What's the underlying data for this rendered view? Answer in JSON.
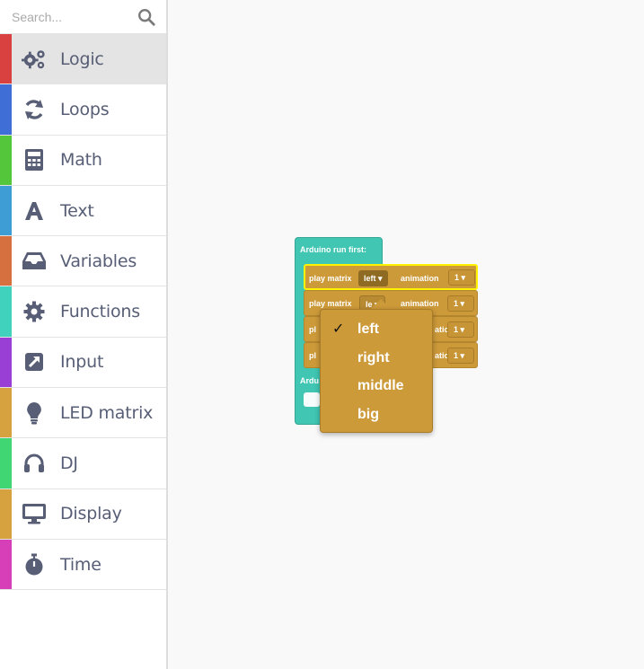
{
  "search": {
    "placeholder": "Search..."
  },
  "sidebar": {
    "categories": [
      {
        "label": "Logic",
        "color": "#d94040",
        "icon": "gears-icon",
        "selected": true
      },
      {
        "label": "Loops",
        "color": "#3f6fd6",
        "icon": "refresh-icon"
      },
      {
        "label": "Math",
        "color": "#53c63b",
        "icon": "calculator-icon"
      },
      {
        "label": "Text",
        "color": "#3f9dd6",
        "icon": "font-icon"
      },
      {
        "label": "Variables",
        "color": "#d6703f",
        "icon": "inbox-icon"
      },
      {
        "label": "Functions",
        "color": "#40d2bd",
        "icon": "gear-icon"
      },
      {
        "label": "Input",
        "color": "#9a3fd6",
        "icon": "external-arrow-icon"
      },
      {
        "label": "LED matrix",
        "color": "#d6a13f",
        "icon": "lightbulb-icon"
      },
      {
        "label": "DJ",
        "color": "#3fd673",
        "icon": "headphones-icon"
      },
      {
        "label": "Display",
        "color": "#d6a13f",
        "icon": "monitor-icon"
      },
      {
        "label": "Time",
        "color": "#d63fb8",
        "icon": "stopwatch-icon"
      }
    ]
  },
  "workspace": {
    "hat_title": "Arduino run first:",
    "hat_title2": "Ardu",
    "blocks": [
      {
        "prefix": "play matrix",
        "value": "left",
        "suffix": "animation",
        "number": "1"
      },
      {
        "prefix": "play matrix",
        "value": "le",
        "suffix": "animation",
        "number": "1"
      },
      {
        "prefix": "pl",
        "value": "",
        "suffix": "ation",
        "number": "1"
      },
      {
        "prefix": "pl",
        "value": "",
        "suffix": "ation",
        "number": "1"
      }
    ]
  },
  "dropdown": {
    "options": [
      {
        "label": "left",
        "checked": true,
        "check_mark": "✓"
      },
      {
        "label": "right",
        "checked": false
      },
      {
        "label": "middle",
        "checked": false
      },
      {
        "label": "big",
        "checked": false
      }
    ]
  }
}
